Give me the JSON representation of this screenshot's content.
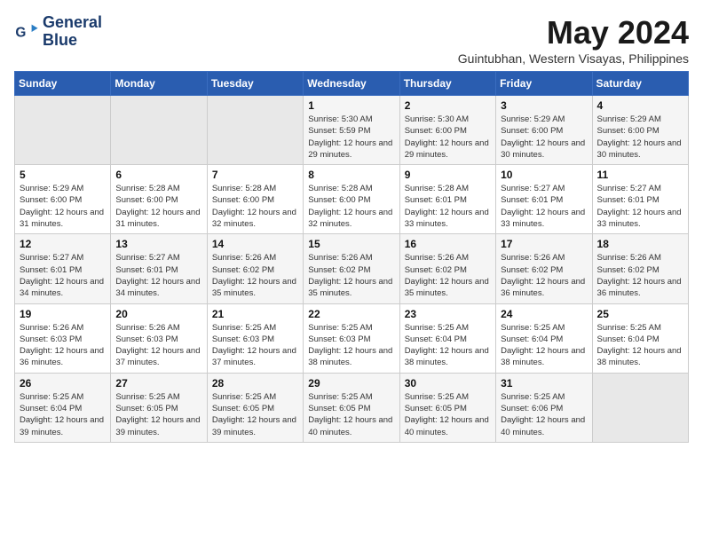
{
  "logo": {
    "line1": "General",
    "line2": "Blue"
  },
  "title": "May 2024",
  "subtitle": "Guintubhan, Western Visayas, Philippines",
  "days_of_week": [
    "Sunday",
    "Monday",
    "Tuesday",
    "Wednesday",
    "Thursday",
    "Friday",
    "Saturday"
  ],
  "weeks": [
    [
      {
        "day": "",
        "sunrise": "",
        "sunset": "",
        "daylight": ""
      },
      {
        "day": "",
        "sunrise": "",
        "sunset": "",
        "daylight": ""
      },
      {
        "day": "",
        "sunrise": "",
        "sunset": "",
        "daylight": ""
      },
      {
        "day": "1",
        "sunrise": "Sunrise: 5:30 AM",
        "sunset": "Sunset: 5:59 PM",
        "daylight": "Daylight: 12 hours and 29 minutes."
      },
      {
        "day": "2",
        "sunrise": "Sunrise: 5:30 AM",
        "sunset": "Sunset: 6:00 PM",
        "daylight": "Daylight: 12 hours and 29 minutes."
      },
      {
        "day": "3",
        "sunrise": "Sunrise: 5:29 AM",
        "sunset": "Sunset: 6:00 PM",
        "daylight": "Daylight: 12 hours and 30 minutes."
      },
      {
        "day": "4",
        "sunrise": "Sunrise: 5:29 AM",
        "sunset": "Sunset: 6:00 PM",
        "daylight": "Daylight: 12 hours and 30 minutes."
      }
    ],
    [
      {
        "day": "5",
        "sunrise": "Sunrise: 5:29 AM",
        "sunset": "Sunset: 6:00 PM",
        "daylight": "Daylight: 12 hours and 31 minutes."
      },
      {
        "day": "6",
        "sunrise": "Sunrise: 5:28 AM",
        "sunset": "Sunset: 6:00 PM",
        "daylight": "Daylight: 12 hours and 31 minutes."
      },
      {
        "day": "7",
        "sunrise": "Sunrise: 5:28 AM",
        "sunset": "Sunset: 6:00 PM",
        "daylight": "Daylight: 12 hours and 32 minutes."
      },
      {
        "day": "8",
        "sunrise": "Sunrise: 5:28 AM",
        "sunset": "Sunset: 6:00 PM",
        "daylight": "Daylight: 12 hours and 32 minutes."
      },
      {
        "day": "9",
        "sunrise": "Sunrise: 5:28 AM",
        "sunset": "Sunset: 6:01 PM",
        "daylight": "Daylight: 12 hours and 33 minutes."
      },
      {
        "day": "10",
        "sunrise": "Sunrise: 5:27 AM",
        "sunset": "Sunset: 6:01 PM",
        "daylight": "Daylight: 12 hours and 33 minutes."
      },
      {
        "day": "11",
        "sunrise": "Sunrise: 5:27 AM",
        "sunset": "Sunset: 6:01 PM",
        "daylight": "Daylight: 12 hours and 33 minutes."
      }
    ],
    [
      {
        "day": "12",
        "sunrise": "Sunrise: 5:27 AM",
        "sunset": "Sunset: 6:01 PM",
        "daylight": "Daylight: 12 hours and 34 minutes."
      },
      {
        "day": "13",
        "sunrise": "Sunrise: 5:27 AM",
        "sunset": "Sunset: 6:01 PM",
        "daylight": "Daylight: 12 hours and 34 minutes."
      },
      {
        "day": "14",
        "sunrise": "Sunrise: 5:26 AM",
        "sunset": "Sunset: 6:02 PM",
        "daylight": "Daylight: 12 hours and 35 minutes."
      },
      {
        "day": "15",
        "sunrise": "Sunrise: 5:26 AM",
        "sunset": "Sunset: 6:02 PM",
        "daylight": "Daylight: 12 hours and 35 minutes."
      },
      {
        "day": "16",
        "sunrise": "Sunrise: 5:26 AM",
        "sunset": "Sunset: 6:02 PM",
        "daylight": "Daylight: 12 hours and 35 minutes."
      },
      {
        "day": "17",
        "sunrise": "Sunrise: 5:26 AM",
        "sunset": "Sunset: 6:02 PM",
        "daylight": "Daylight: 12 hours and 36 minutes."
      },
      {
        "day": "18",
        "sunrise": "Sunrise: 5:26 AM",
        "sunset": "Sunset: 6:02 PM",
        "daylight": "Daylight: 12 hours and 36 minutes."
      }
    ],
    [
      {
        "day": "19",
        "sunrise": "Sunrise: 5:26 AM",
        "sunset": "Sunset: 6:03 PM",
        "daylight": "Daylight: 12 hours and 36 minutes."
      },
      {
        "day": "20",
        "sunrise": "Sunrise: 5:26 AM",
        "sunset": "Sunset: 6:03 PM",
        "daylight": "Daylight: 12 hours and 37 minutes."
      },
      {
        "day": "21",
        "sunrise": "Sunrise: 5:25 AM",
        "sunset": "Sunset: 6:03 PM",
        "daylight": "Daylight: 12 hours and 37 minutes."
      },
      {
        "day": "22",
        "sunrise": "Sunrise: 5:25 AM",
        "sunset": "Sunset: 6:03 PM",
        "daylight": "Daylight: 12 hours and 38 minutes."
      },
      {
        "day": "23",
        "sunrise": "Sunrise: 5:25 AM",
        "sunset": "Sunset: 6:04 PM",
        "daylight": "Daylight: 12 hours and 38 minutes."
      },
      {
        "day": "24",
        "sunrise": "Sunrise: 5:25 AM",
        "sunset": "Sunset: 6:04 PM",
        "daylight": "Daylight: 12 hours and 38 minutes."
      },
      {
        "day": "25",
        "sunrise": "Sunrise: 5:25 AM",
        "sunset": "Sunset: 6:04 PM",
        "daylight": "Daylight: 12 hours and 38 minutes."
      }
    ],
    [
      {
        "day": "26",
        "sunrise": "Sunrise: 5:25 AM",
        "sunset": "Sunset: 6:04 PM",
        "daylight": "Daylight: 12 hours and 39 minutes."
      },
      {
        "day": "27",
        "sunrise": "Sunrise: 5:25 AM",
        "sunset": "Sunset: 6:05 PM",
        "daylight": "Daylight: 12 hours and 39 minutes."
      },
      {
        "day": "28",
        "sunrise": "Sunrise: 5:25 AM",
        "sunset": "Sunset: 6:05 PM",
        "daylight": "Daylight: 12 hours and 39 minutes."
      },
      {
        "day": "29",
        "sunrise": "Sunrise: 5:25 AM",
        "sunset": "Sunset: 6:05 PM",
        "daylight": "Daylight: 12 hours and 40 minutes."
      },
      {
        "day": "30",
        "sunrise": "Sunrise: 5:25 AM",
        "sunset": "Sunset: 6:05 PM",
        "daylight": "Daylight: 12 hours and 40 minutes."
      },
      {
        "day": "31",
        "sunrise": "Sunrise: 5:25 AM",
        "sunset": "Sunset: 6:06 PM",
        "daylight": "Daylight: 12 hours and 40 minutes."
      },
      {
        "day": "",
        "sunrise": "",
        "sunset": "",
        "daylight": ""
      }
    ]
  ]
}
